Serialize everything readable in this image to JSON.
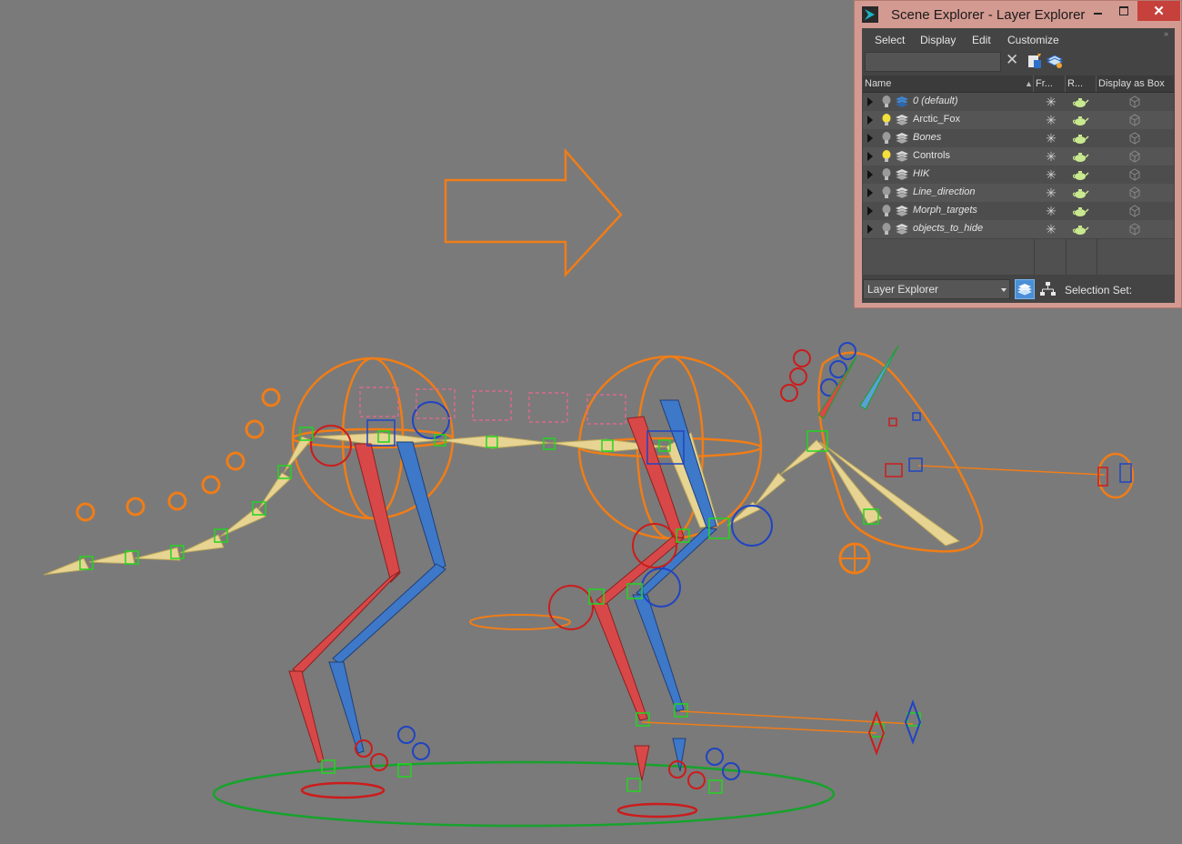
{
  "window": {
    "title": "Scene Explorer - Layer Explorer",
    "close_symbol": "✕",
    "menu": [
      "Select",
      "Display",
      "Edit",
      "Customize"
    ],
    "search_value": "",
    "clear_symbol": "✕",
    "columns": {
      "name": "Name",
      "frozen": "Fr...",
      "render": "R...",
      "display_box": "Display as Box"
    },
    "layers": [
      {
        "name": "0 (default)",
        "italic": true,
        "bulb_on": false
      },
      {
        "name": "Arctic_Fox",
        "italic": false,
        "bulb_on": true
      },
      {
        "name": "Bones",
        "italic": true,
        "bulb_on": false
      },
      {
        "name": "Controls",
        "italic": false,
        "bulb_on": true
      },
      {
        "name": "HIK",
        "italic": true,
        "bulb_on": false
      },
      {
        "name": "Line_direction",
        "italic": true,
        "bulb_on": false
      },
      {
        "name": "Morph_targets",
        "italic": true,
        "bulb_on": false
      },
      {
        "name": "objects_to_hide",
        "italic": true,
        "bulb_on": false
      }
    ],
    "explorer_dropdown": "Layer Explorer",
    "selection_set_label": "Selection Set:",
    "more_symbol": "»",
    "freeze_symbol": "✳"
  },
  "colors": {
    "viewport_bg": "#7a7a7a",
    "window_frame": "#d39a91",
    "panel_bg": "#444444",
    "accent_blue": "#4a8fd6"
  },
  "icons": {
    "app": "3dsmax-app-icon",
    "new_layer": "create-layer-icon",
    "add_to_layer": "add-to-layer-icon",
    "bulb": "lightbulb-icon",
    "layer": "layer-stack-icon",
    "freeze": "freeze-snowflake-icon",
    "render": "teapot-render-icon",
    "box": "display-box-icon"
  }
}
